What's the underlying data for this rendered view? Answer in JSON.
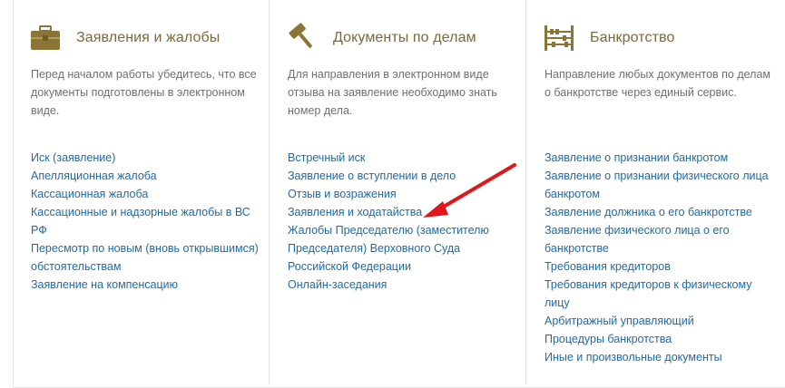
{
  "columns": [
    {
      "icon": "briefcase-icon",
      "title": "Заявления и жалобы",
      "description": "Перед началом работы убедитесь, что все документы подготовлены в электронном виде.",
      "links": [
        "Иск (заявление)",
        "Апелляционная жалоба",
        "Кассационная жалоба",
        "Кассационные и надзорные жалобы в ВС РФ",
        "Пересмотр по новым (вновь открывшимся) обстоятельствам",
        "Заявление на компенсацию"
      ]
    },
    {
      "icon": "gavel-icon",
      "title": "Документы по делам",
      "description": "Для направления в электронном виде отзыва на заявление необходимо знать номер дела.",
      "links": [
        "Встречный иск",
        "Заявление о вступлении в дело",
        "Отзыв и возражения",
        "Заявления и ходатайства",
        "Жалобы Председателю (заместителю Председателя) Верховного Суда Российской Федерации",
        "Онлайн-заседания"
      ]
    },
    {
      "icon": "abacus-icon",
      "title": "Банкротство",
      "description": "Направление любых документов по делам о банкротстве через единый сервис.",
      "links": [
        "Заявление о признании банкротом",
        "Заявление о признании физического лица банкротом",
        "Заявление должника о его банкротстве",
        "Заявление физического лица о его банкротстве",
        "Требования кредиторов",
        "Требования кредиторов к физическому лицу",
        "Арбитражный управляющий",
        "Процедуры банкротства",
        "Иные и произвольные документы"
      ]
    }
  ],
  "colors": {
    "title": "#7a6a3a",
    "link": "#1f6aa5",
    "text": "#6f6f6f",
    "annotation_arrow": "#e0161b"
  },
  "annotation": {
    "type": "arrow",
    "points_to": "Заявления и ходатайства"
  }
}
